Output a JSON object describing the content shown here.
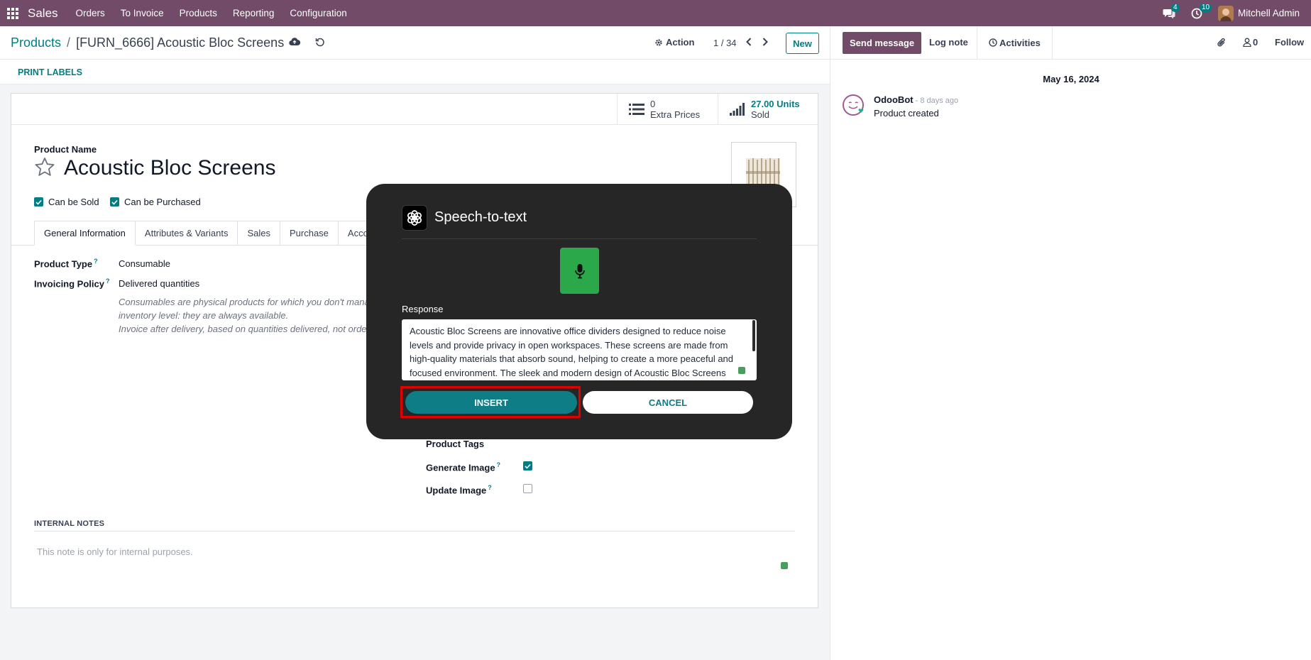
{
  "navbar": {
    "brand": "Sales",
    "menu": [
      "Orders",
      "To Invoice",
      "Products",
      "Reporting",
      "Configuration"
    ],
    "messages_count": "4",
    "activities_count": "10",
    "user_name": "Mitchell Admin",
    "bg_color": "#714b67"
  },
  "breadcrumb": {
    "parent": "Products",
    "separator": "/",
    "current": "[FURN_6666] Acoustic Bloc Screens"
  },
  "control": {
    "action_label": "Action",
    "pager": "1 / 34",
    "new_label": "New"
  },
  "statusbar": {
    "print_labels": "PRINT LABELS"
  },
  "stat_buttons": {
    "extra_prices_value": "0",
    "extra_prices_label": "Extra Prices",
    "sold_value": "27.00 Units",
    "sold_label": "Sold"
  },
  "product": {
    "name_label": "Product Name",
    "name": "Acoustic Bloc Screens",
    "can_be_sold": "Can be Sold",
    "can_be_purchased": "Can be Purchased"
  },
  "tabs": [
    "General Information",
    "Attributes & Variants",
    "Sales",
    "Purchase",
    "Accou"
  ],
  "general": {
    "product_type_label": "Product Type",
    "product_type_value": "Consumable",
    "invoicing_policy_label": "Invoicing Policy",
    "invoicing_policy_value": "Delivered quantities",
    "consumable_help": "Consumables are physical products for which you don't mana inventory level: they are always available.",
    "invoice_help": "Invoice after delivery, based on quantities delivered, not order",
    "help_marker": "?"
  },
  "right_fields": {
    "product_tags": "Product Tags",
    "generate_image": "Generate Image",
    "generate_image_checked": true,
    "update_image": "Update Image",
    "update_image_checked": false
  },
  "notes": {
    "title": "INTERNAL NOTES",
    "placeholder": "This note is only for internal purposes."
  },
  "chatter": {
    "send_message": "Send message",
    "log_note": "Log note",
    "activities": "Activities",
    "followers_count": "0",
    "follow": "Follow",
    "date": "May 16, 2024",
    "message": {
      "author": "OdooBot",
      "time": "- 8 days ago",
      "body": "Product created"
    }
  },
  "dialog": {
    "title": "Speech-to-text",
    "response_label": "Response",
    "response_text": "Acoustic Bloc Screens are innovative office dividers designed to reduce noise levels and provide privacy in open workspaces. These screens are made from high-quality materials that absorb sound, helping to create a more peaceful and focused environment. The sleek and modern design of Acoustic Bloc Screens",
    "insert_label": "INSERT",
    "cancel_label": "CANCEL",
    "mic_color": "#2aa84a",
    "highlight_color": "#e00000"
  },
  "colors": {
    "accent": "#017e84",
    "brand": "#714b67"
  }
}
